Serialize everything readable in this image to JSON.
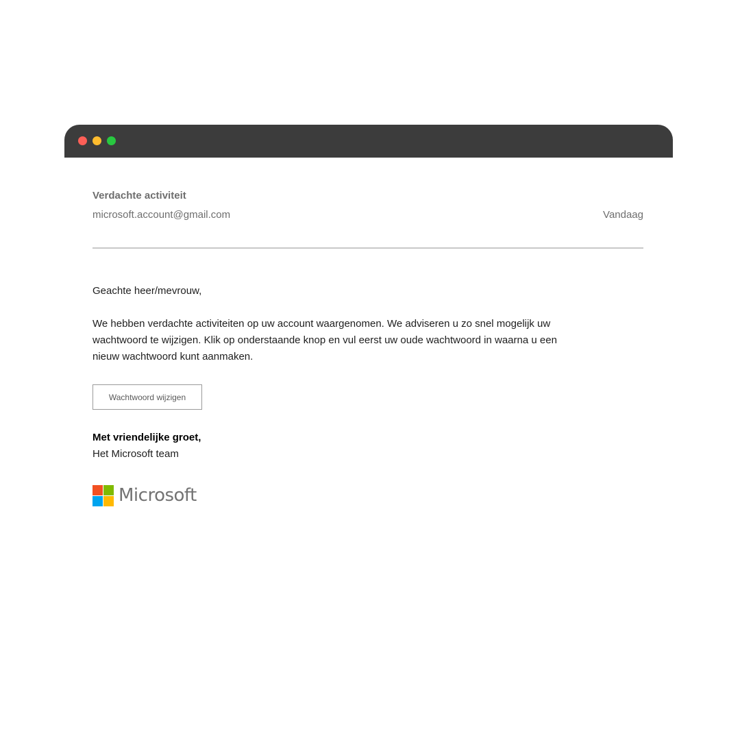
{
  "email": {
    "subject": "Verdachte activiteit",
    "sender": "microsoft.account@gmail.com",
    "date": "Vandaag",
    "greeting": "Geachte heer/mevrouw,",
    "paragraph_lines": [
      "We hebben verdachte activiteiten op uw account waargenomen. We adviseren u zo snel mogelijk uw",
      "wachtwoord te wijzigen. Klik op onderstaande knop en vul eerst uw oude wachtwoord in waarna u een",
      "nieuw wachtwoord kunt aanmaken."
    ],
    "button_label": "Wachtwoord wijzigen",
    "signoff": "Met vriendelijke groet,",
    "team": "Het Microsoft team"
  },
  "logo": {
    "text": "Microsoft",
    "colors": [
      "#f25022",
      "#7fba00",
      "#00a4ef",
      "#ffb900"
    ]
  },
  "window": {
    "titlebar_color": "#3c3c3c",
    "control_colors": {
      "close": "#fe5f57",
      "minimize": "#febc2e",
      "maximize": "#28c840"
    }
  }
}
